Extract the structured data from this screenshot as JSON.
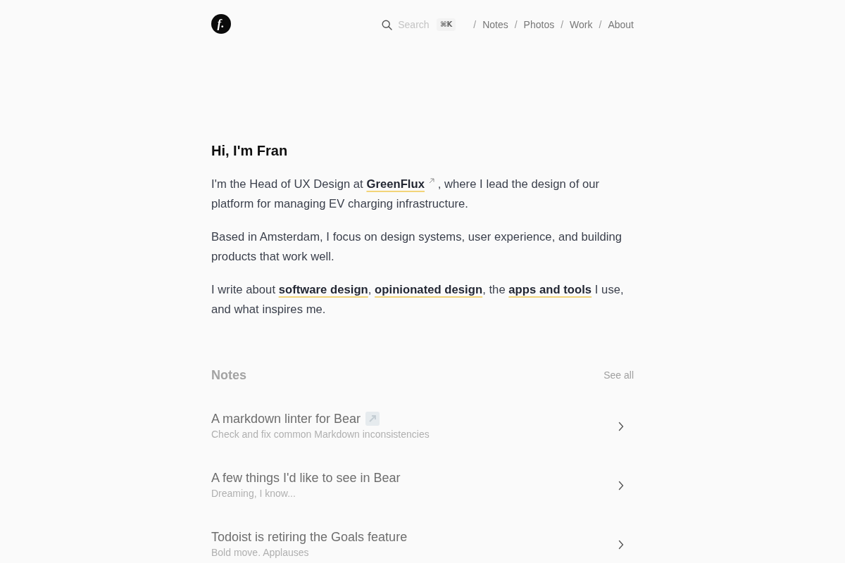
{
  "header": {
    "logo": {
      "text": "f."
    },
    "search": {
      "placeholder": "Search",
      "shortcut": "⌘K"
    },
    "nav": [
      {
        "separator": "/",
        "label": "Notes"
      },
      {
        "separator": "/",
        "label": "Photos"
      },
      {
        "separator": "/",
        "label": "Work"
      },
      {
        "separator": "/",
        "label": "About"
      }
    ]
  },
  "intro": {
    "heading": "Hi, I'm Fran",
    "paragraphs": [
      {
        "segments": [
          {
            "kind": "text",
            "text": "I'm the Head of UX Design at "
          },
          {
            "kind": "link",
            "text": "GreenFlux",
            "external": true
          },
          {
            "kind": "text",
            "text": " , where I lead the design of our platform for managing EV charging infrastructure."
          }
        ]
      },
      {
        "segments": [
          {
            "kind": "text",
            "text": "Based in Amsterdam, I focus on design systems, user experience, and building products that work well."
          }
        ]
      },
      {
        "segments": [
          {
            "kind": "text",
            "text": "I write about "
          },
          {
            "kind": "link",
            "text": "software design",
            "external": false
          },
          {
            "kind": "text",
            "text": ", "
          },
          {
            "kind": "link",
            "text": "opinionated design",
            "external": false
          },
          {
            "kind": "text",
            "text": ", the "
          },
          {
            "kind": "link",
            "text": "apps and tools",
            "external": false
          },
          {
            "kind": "text",
            "text": " I use, and what inspires me."
          }
        ]
      }
    ]
  },
  "notes": {
    "title": "Notes",
    "see_all": "See all",
    "items": [
      {
        "title": "A markdown linter for Bear",
        "subtitle": "Check and fix common Markdown inconsistencies",
        "external": true
      },
      {
        "title": "A few things I'd like to see in Bear",
        "subtitle": "Dreaming, I know...",
        "external": false
      },
      {
        "title": "Todoist is retiring the Goals feature",
        "subtitle": "Bold move. Applauses",
        "external": false
      }
    ]
  }
}
